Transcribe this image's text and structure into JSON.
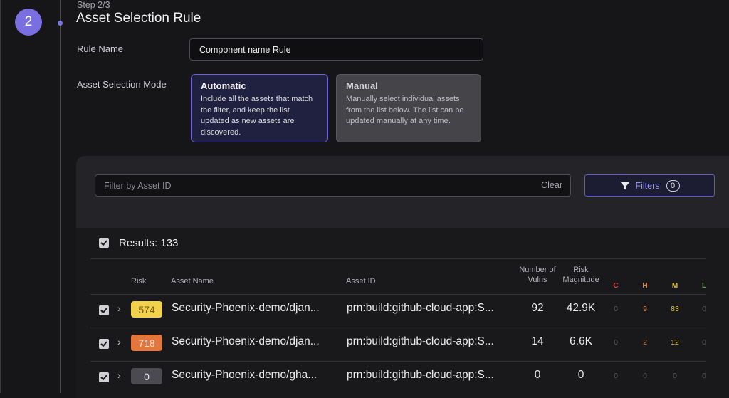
{
  "step": {
    "number": "2",
    "label": "Step 2/3",
    "title": "Asset Selection Rule"
  },
  "rule_name": {
    "label": "Rule Name",
    "value": "Component name Rule"
  },
  "mode": {
    "label": "Asset Selection Mode",
    "automatic": {
      "title": "Automatic",
      "description": "Include all the assets that match the filter, and keep the list updated as new assets are discovered."
    },
    "manual": {
      "title": "Manual",
      "description": "Manually select individual assets from the list below. The list can be updated manually at any time."
    }
  },
  "filter": {
    "placeholder": "Filter by Asset ID",
    "clear_label": "Clear",
    "filters_label": "Filters",
    "filters_count": "0"
  },
  "results": {
    "label": "Results: 133"
  },
  "table": {
    "headers": {
      "risk": "Risk",
      "asset_name": "Asset Name",
      "asset_id": "Asset ID",
      "vulns_line1": "Number of",
      "vulns_line2": "Vulns",
      "magnitude_line1": "Risk",
      "magnitude_line2": "Magnitude",
      "c": "C",
      "h": "H",
      "m": "M",
      "l": "L"
    },
    "rows": [
      {
        "risk": "574",
        "asset_name": "Security-Phoenix-demo/djan...",
        "asset_id": "prn:build:github-cloud-app:S...",
        "vulns": "92",
        "magnitude": "42.9K",
        "c": "0",
        "h": "9",
        "m": "83",
        "l": "0"
      },
      {
        "risk": "718",
        "asset_name": "Security-Phoenix-demo/djan...",
        "asset_id": "prn:build:github-cloud-app:S...",
        "vulns": "14",
        "magnitude": "6.6K",
        "c": "0",
        "h": "2",
        "m": "12",
        "l": "0"
      },
      {
        "risk": "0",
        "asset_name": "Security-Phoenix-demo/gha...",
        "asset_id": "prn:build:github-cloud-app:S...",
        "vulns": "0",
        "magnitude": "0",
        "c": "0",
        "h": "0",
        "m": "0",
        "l": "0"
      }
    ]
  },
  "colors": {
    "accent": "#7a6fe0",
    "badge_yellow": "#f2d24a",
    "badge_orange": "#e2763d",
    "badge_gray": "#4a4a50",
    "sev_c": "#d9473c",
    "sev_h": "#e3873a",
    "sev_m": "#e6c437",
    "sev_l": "#5bb04f"
  }
}
